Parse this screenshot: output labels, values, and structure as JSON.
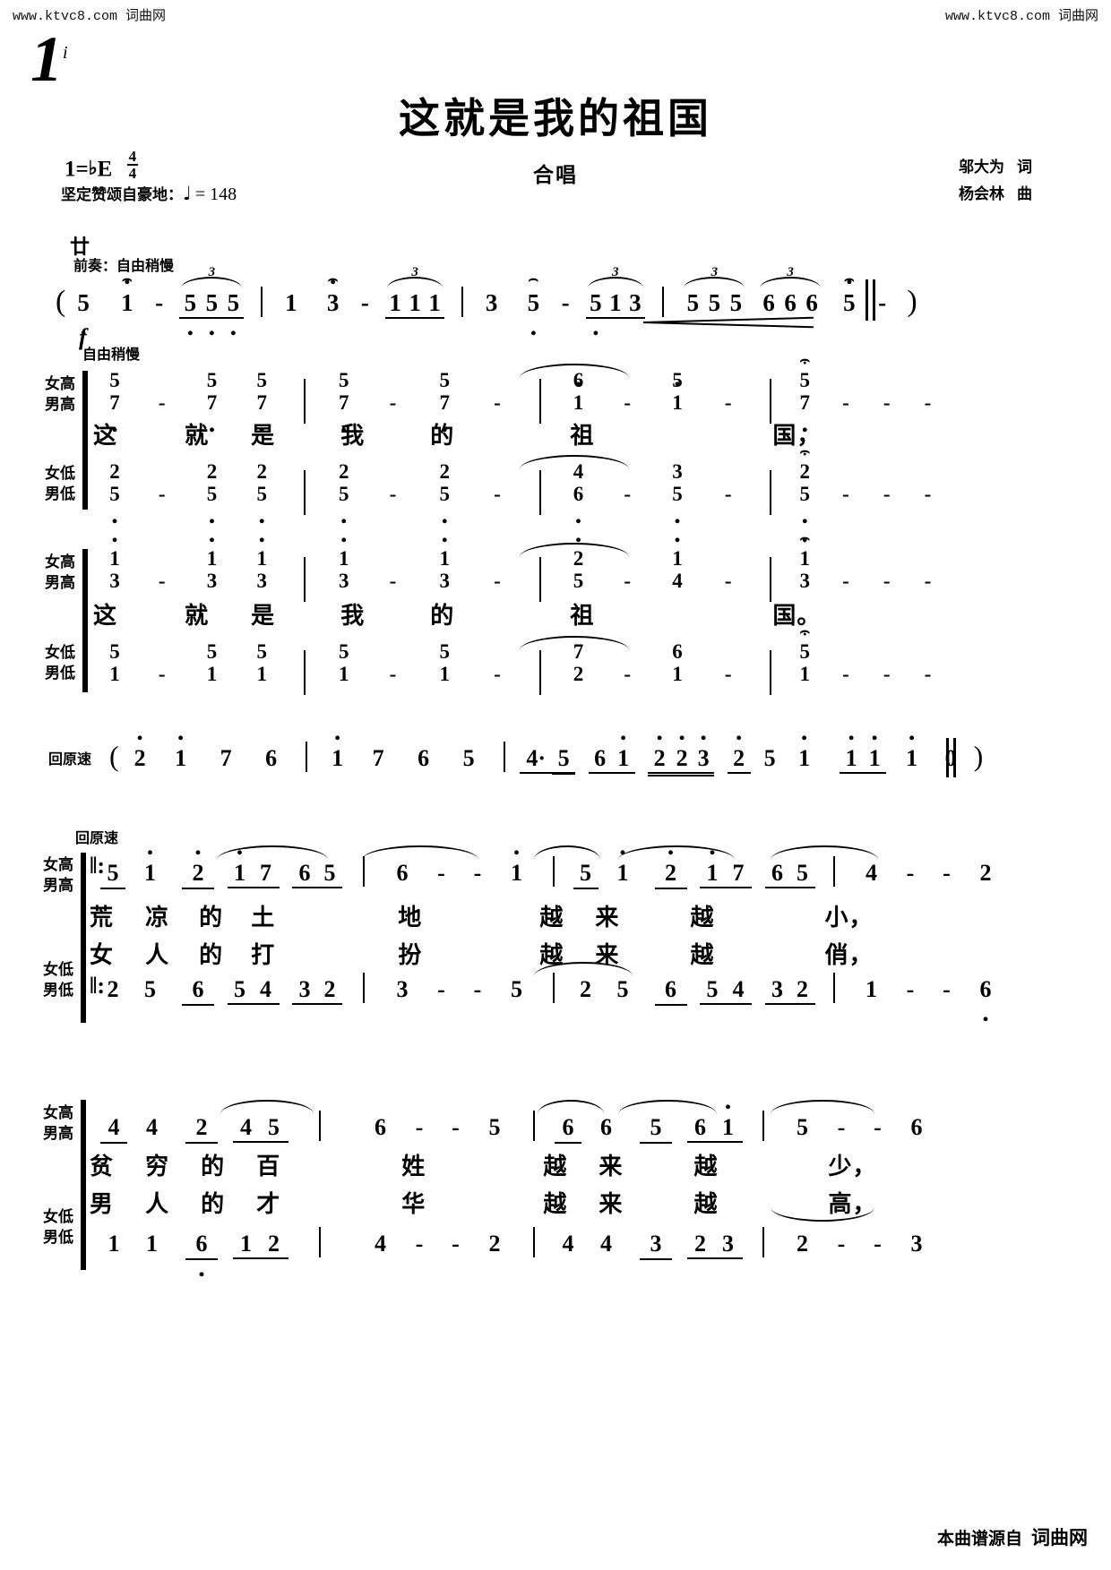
{
  "watermark": {
    "left": "www.ktvc8.com 词曲网",
    "right": "www.ktvc8.com 词曲网"
  },
  "page_number": "1",
  "header": {
    "title": "这就是我的祖国",
    "subtitle": "合唱",
    "key": "1=",
    "key_accidental": "♭",
    "key_letter": "E",
    "time_top": "4",
    "time_bottom": "4",
    "expression": "坚定赞颂自豪地：",
    "tempo_value": "= 148",
    "lyricist_name": "邬大为",
    "lyricist_role": "词",
    "composer_name": "杨会林",
    "composer_role": "曲"
  },
  "prelude": {
    "sign": "廿",
    "label": "前奏：自由稍慢",
    "open_paren": "(",
    "close_paren": ")",
    "measures": [
      {
        "notes": [
          "5",
          "1",
          "-",
          "5",
          "5",
          "5"
        ]
      },
      {
        "notes": [
          "1",
          "3",
          "-",
          "1",
          "1",
          "1"
        ]
      },
      {
        "notes": [
          "3",
          "5",
          "-",
          "5",
          "1",
          "3"
        ]
      },
      {
        "notes": [
          "5",
          "5",
          "5",
          "6",
          "6",
          "6",
          "5",
          "-"
        ]
      }
    ],
    "triplet_number": "3"
  },
  "system1": {
    "dynamic": "f",
    "tempo_mark": "自由稍慢",
    "upper_label_1": "女高",
    "upper_label_2": "男高",
    "lower_label_1": "女低",
    "lower_label_2": "男低",
    "upper_notes": [
      [
        "5",
        "7",
        "-",
        "5",
        "7",
        "5",
        "7"
      ],
      [
        "5",
        "7",
        "-",
        "5",
        "7",
        "-"
      ],
      [
        "6",
        "1",
        "-",
        "5",
        "1",
        "-"
      ],
      [
        "5",
        "7",
        "-",
        "-",
        "-"
      ]
    ],
    "lower_notes": [
      [
        "2",
        "5",
        "-",
        "2",
        "5",
        "2",
        "5"
      ],
      [
        "2",
        "5",
        "-",
        "2",
        "5",
        "-"
      ],
      [
        "4",
        "6",
        "-",
        "3",
        "5",
        "-"
      ],
      [
        "2",
        "5",
        "-",
        "-",
        "-"
      ]
    ],
    "lyrics": [
      "这",
      "就",
      "是",
      "我",
      "的",
      "祖",
      "国，"
    ]
  },
  "system2": {
    "upper_label_1": "女高",
    "upper_label_2": "男高",
    "lower_label_1": "女低",
    "lower_label_2": "男低",
    "upper_notes": [
      [
        "1",
        "3",
        "-",
        "1",
        "3",
        "1",
        "3"
      ],
      [
        "1",
        "3",
        "-",
        "1",
        "3",
        "-"
      ],
      [
        "2",
        "5",
        "-",
        "1",
        "4",
        "-"
      ],
      [
        "1",
        "3",
        "-",
        "-",
        "-"
      ]
    ],
    "lower_notes": [
      [
        "5",
        "1",
        "-",
        "5",
        "1",
        "5",
        "1"
      ],
      [
        "5",
        "1",
        "-",
        "5",
        "1",
        "-"
      ],
      [
        "7",
        "2",
        "-",
        "6",
        "1",
        "-"
      ],
      [
        "5",
        "1",
        "-",
        "-",
        "-"
      ]
    ],
    "lyrics": [
      "这",
      "就",
      "是",
      "我",
      "的",
      "祖",
      "国。"
    ]
  },
  "interlude": {
    "label": "回原速",
    "open_paren": "(",
    "close_paren": ")",
    "measures": [
      [
        "2",
        "1",
        "7",
        "6"
      ],
      [
        "1",
        "7",
        "6",
        "5"
      ],
      [
        "4·",
        "5",
        "6",
        "1",
        "2",
        "2",
        "3",
        "2",
        "5",
        "1",
        "1",
        "1",
        "1",
        "0"
      ]
    ]
  },
  "system3": {
    "tempo_mark": "回原速",
    "upper_label_1": "女高",
    "upper_label_2": "男高",
    "lower_label_1": "女低",
    "lower_label_2": "男低",
    "repeat_open": "‖:",
    "upper_notes": [
      [
        "5",
        "1",
        "2",
        "1",
        "7",
        "6",
        "5"
      ],
      [
        "6",
        "-",
        "-",
        "1"
      ],
      [
        "5",
        "1",
        "2",
        "1",
        "7",
        "6",
        "5"
      ],
      [
        "4",
        "-",
        "-",
        "2"
      ]
    ],
    "lower_notes": [
      [
        "2",
        "5",
        "6",
        "5",
        "4",
        "3",
        "2"
      ],
      [
        "3",
        "-",
        "-",
        "5"
      ],
      [
        "2",
        "5",
        "6",
        "5",
        "4",
        "3",
        "2"
      ],
      [
        "1",
        "-",
        "-",
        "6"
      ]
    ],
    "lyrics_row1": [
      "荒",
      "凉",
      "的",
      "土",
      "地",
      "越",
      "来",
      "越",
      "小，"
    ],
    "lyrics_row2": [
      "女",
      "人",
      "的",
      "打",
      "扮",
      "越",
      "来",
      "越",
      "俏，"
    ]
  },
  "system4": {
    "upper_label_1": "女高",
    "upper_label_2": "男高",
    "lower_label_1": "女低",
    "lower_label_2": "男低",
    "upper_notes": [
      [
        "4",
        "4",
        "2",
        "4",
        "5"
      ],
      [
        "6",
        "-",
        "-",
        "5"
      ],
      [
        "6",
        "6",
        "5",
        "6",
        "1"
      ],
      [
        "5",
        "-",
        "-",
        "6"
      ]
    ],
    "lower_notes": [
      [
        "1",
        "1",
        "6",
        "1",
        "2"
      ],
      [
        "4",
        "-",
        "-",
        "2"
      ],
      [
        "4",
        "4",
        "3",
        "2",
        "3"
      ],
      [
        "2",
        "-",
        "-",
        "3"
      ]
    ],
    "lyrics_row1": [
      "贫",
      "穷",
      "的",
      "百",
      "姓",
      "越",
      "来",
      "越",
      "少，"
    ],
    "lyrics_row2": [
      "男",
      "人",
      "的",
      "才",
      "华",
      "越",
      "来",
      "越",
      "高，"
    ]
  },
  "footer": {
    "text": "本曲谱源自",
    "site": "词曲网"
  }
}
